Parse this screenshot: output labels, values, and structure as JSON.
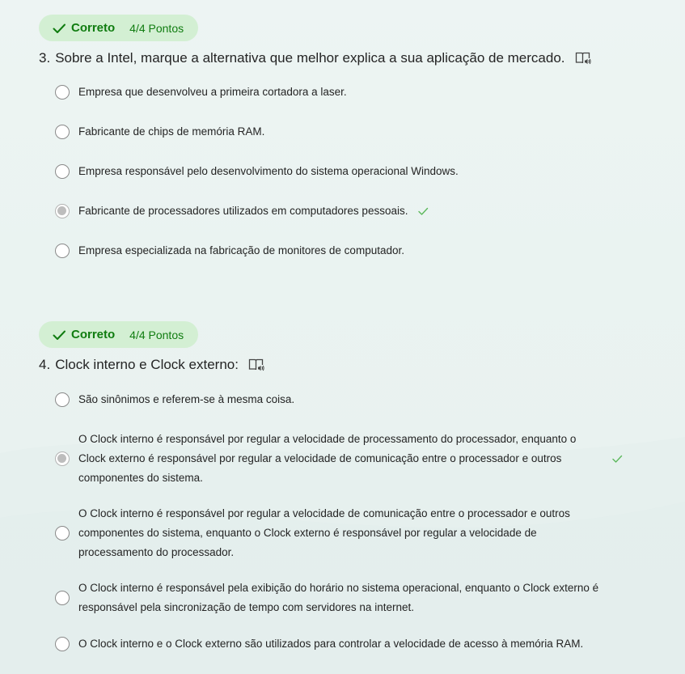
{
  "questions": [
    {
      "status": "Correto",
      "points": "4/4 Pontos",
      "number": "3.",
      "title": "Sobre a Intel, marque a alternativa que melhor explica a sua aplicação de mercado.",
      "options": [
        "Empresa que desenvolveu a primeira cortadora a laser.",
        "Fabricante de chips de memória RAM.",
        "Empresa responsável pelo desenvolvimento do sistema operacional Windows.",
        "Fabricante de processadores utilizados em computadores pessoais.",
        "Empresa especializada na fabricação de monitores de computador."
      ],
      "selected_index": 3
    },
    {
      "status": "Correto",
      "points": "4/4 Pontos",
      "number": "4.",
      "title": "Clock interno e Clock externo:",
      "options": [
        "São sinônimos e referem-se à mesma coisa.",
        "O Clock interno é responsável por regular a velocidade de processamento do processador, enquanto o Clock externo é responsável por regular a velocidade de comunicação entre o processador e outros componentes do sistema.",
        "O Clock interno é responsável por regular a velocidade de comunicação entre o processador e outros componentes do sistema, enquanto o Clock externo é responsável por regular a velocidade de processamento do processador.",
        "O Clock interno é responsável pela exibição do horário no sistema operacional, enquanto o Clock externo é responsável pela sincronização de tempo com servidores na internet.",
        "O Clock interno e o Clock externo são utilizados para controlar a velocidade de acesso à memória RAM."
      ],
      "selected_index": 1
    }
  ],
  "icons": {
    "status": "checkmark-icon",
    "reader": "immersive-reader-icon",
    "correct": "checkmark-icon"
  },
  "colors": {
    "badge_bg": "#d3efd3",
    "success": "#107c10",
    "correct_mark": "#5cb85c",
    "background": "#eaf3f1"
  }
}
